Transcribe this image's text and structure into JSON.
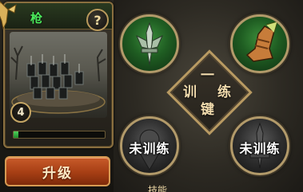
{
  "unit": {
    "name": "枪",
    "help": "?",
    "level": "4",
    "exp_progress": 0.05
  },
  "actions": {
    "upgrade_label": "升级"
  },
  "train_all": {
    "chars": [
      "一",
      "训",
      "练",
      "键"
    ]
  },
  "skills": [
    {
      "icon": "trident-sword-icon",
      "state": "trained",
      "label": ""
    },
    {
      "icon": "war-boot-icon",
      "state": "trained",
      "label": ""
    },
    {
      "icon": "shadow-skull-icon",
      "state": "untrained",
      "label": "未训练"
    },
    {
      "icon": "shadow-sword-icon",
      "state": "untrained",
      "label": "未训练"
    }
  ],
  "bottom_tab": {
    "label": "技能"
  },
  "colors": {
    "unit_name": "#4bea5c",
    "upgrade_button": "#b0441a",
    "frame_gold": "#b89a62"
  }
}
